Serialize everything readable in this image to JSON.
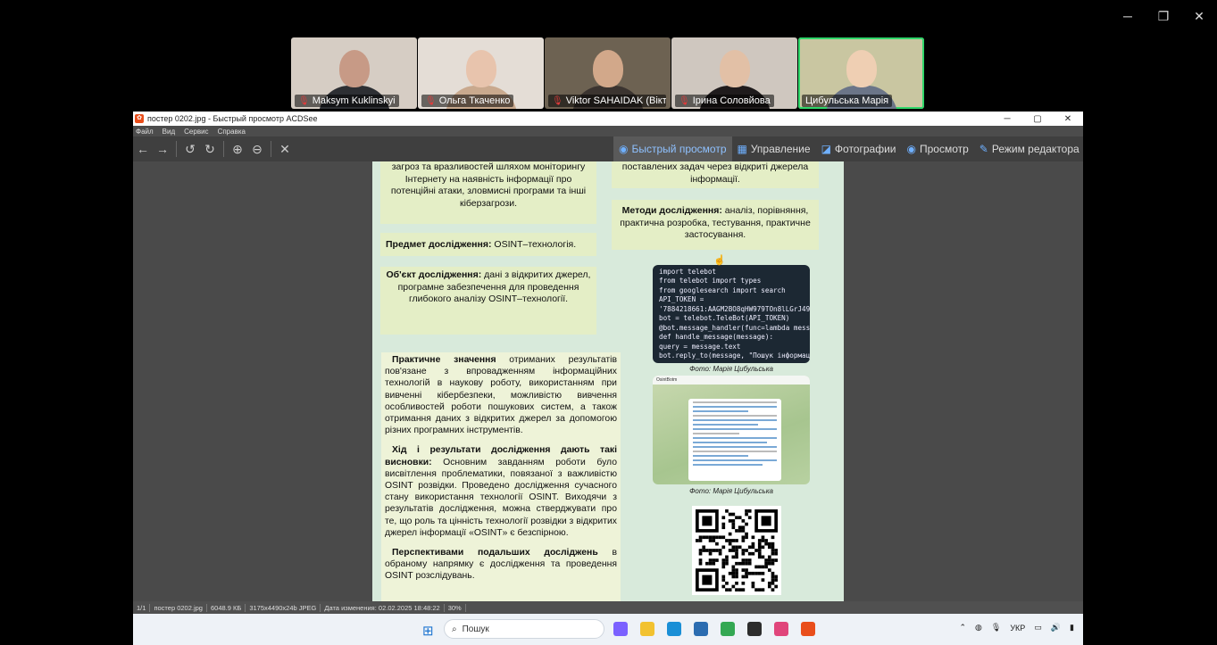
{
  "window_controls": {
    "minimize": "─",
    "restore": "❐",
    "close": "✕"
  },
  "participants": [
    {
      "name": "Maksym Kuklinskyi",
      "muted": true,
      "bg": "#d6cdc4",
      "face": "#c79a86",
      "body": "#2d2f33"
    },
    {
      "name": "Ольга Ткаченко",
      "muted": true,
      "bg": "#e4ddd6",
      "face": "#e8c4ad",
      "body": "#c9a98e"
    },
    {
      "name": "Viktor SAHAIDAK (Вікт...",
      "muted": true,
      "bg": "#6d6252",
      "face": "#d2a88a",
      "body": "#3b3430"
    },
    {
      "name": "Ірина Соловйова",
      "muted": true,
      "bg": "#cfc7bf",
      "face": "#e2c0a6",
      "body": "#1f1b1c"
    },
    {
      "name": "Цибульська Марія",
      "muted": false,
      "bg": "#c9c6a1",
      "face": "#efcfb3",
      "body": "#6b7588"
    }
  ],
  "viewer": {
    "title": "постер 0202.jpg - Быстрый просмотр ACDSee",
    "menu": [
      "Файл",
      "Вид",
      "Сервис",
      "Справка"
    ],
    "tools": [
      {
        "name": "back-icon",
        "glyph": "←"
      },
      {
        "name": "forward-icon",
        "glyph": "→"
      },
      {
        "name": "rotate-left-icon",
        "glyph": "↺"
      },
      {
        "name": "rotate-right-icon",
        "glyph": "↻"
      },
      {
        "name": "zoom-in-icon",
        "glyph": "⊕"
      },
      {
        "name": "zoom-out-icon",
        "glyph": "⊖"
      },
      {
        "name": "close-icon",
        "glyph": "✕"
      }
    ],
    "modes": [
      {
        "label": "Быстрый просмотр",
        "icon": "◉",
        "selected": true
      },
      {
        "label": "Управление",
        "icon": "▦",
        "selected": false
      },
      {
        "label": "Фотографии",
        "icon": "◪",
        "selected": false
      },
      {
        "label": "Просмотр",
        "icon": "◉",
        "selected": false
      },
      {
        "label": "Режим редактора",
        "icon": "✎",
        "selected": false
      }
    ],
    "status": [
      "1/1",
      "постер 0202.jpg",
      "6048.9 КБ",
      "3175x4490x24b JPEG",
      "Дата изменения: 02.02.2025 18:48:22",
      "30%"
    ]
  },
  "poster": {
    "box_top_left": "загроз та вразливостей шляхом моніторингу Інтернету на наявність інформації про потенційні атаки, зловмисні програми та інші кіберзагрози.",
    "subject_label": "Предмет дослідження:",
    "subject_text": " OSINT–технологія.",
    "object_label": "Об'єкт дослідження:",
    "object_text": " дані з відкритих джерел, програмне забезпечення для проведення глибокого аналізу OSINT–технології.",
    "box_top_right": "поставлених задач через відкриті джерела інформації.",
    "methods_label": "Методи дослідження:",
    "methods_text": " аналіз, порівняння, практична розробка, тестування, практичне застосування.",
    "practical_label": "Практичне значення",
    "practical_text": " отриманих результатів пов'язане з впровадженням інформаційних технологій в наукову роботу, використанням при вивченні кібербезпеки, можливістю вивчення особливостей роботи пошукових систем, а також отримання даних з відкритих джерел за допомогою різних програмних інструментів.",
    "results_label": "Хід і результати дослідження дають такі висновки:",
    "results_text": " Основним завданням роботи було висвітлення проблематики, повязаної з важливістю OSINT розвідки. Проведено дослідження сучасного стану використання технології OSINT. Виходячи з результатів дослідження, можна стверджувати про те, що роль та цінність технології розвідки з відкритих джерел інформації «OSINT» є безспірною.",
    "prospects_label": "Перспективами подальших досліджень",
    "prospects_text": " в обраному напрямку є дослідження та проведення OSINT розслідувань.",
    "code_lines": [
      "import telebot",
      "from telebot import types",
      "from googlesearch import search",
      "API_TOKEN =",
      "'7884218661:AAGM2BO8qHW979TOn8lLGrJ493",
      "bot = telebot.TeleBot(API_TOKEN)",
      "@bot.message_handler(func=lambda message",
      "def handle_message(message):",
      "    query = message.text",
      "        bot.reply_to(message, \"Пошук інформаці"
    ],
    "caption1": "Фото: Марія Цибульська",
    "caption2": "Фото: Марія Цибульська",
    "chat_header": "OsintBotm"
  },
  "taskbar": {
    "search_label": "Пошук",
    "language": "УКР",
    "apps": [
      {
        "name": "copilot-app-icon",
        "color": "#7b61ff"
      },
      {
        "name": "file-explorer-icon",
        "color": "#f2c230"
      },
      {
        "name": "edge-browser-icon",
        "color": "#1a8fd6"
      },
      {
        "name": "store-app-icon",
        "color": "#2b6cb0"
      },
      {
        "name": "chrome-browser-icon",
        "color": "#34a853"
      },
      {
        "name": "terminal-app-icon",
        "color": "#2d2d2d"
      },
      {
        "name": "paint-app-icon",
        "color": "#e0457b"
      },
      {
        "name": "acdsee-app-icon",
        "color": "#e94e1b"
      }
    ]
  }
}
